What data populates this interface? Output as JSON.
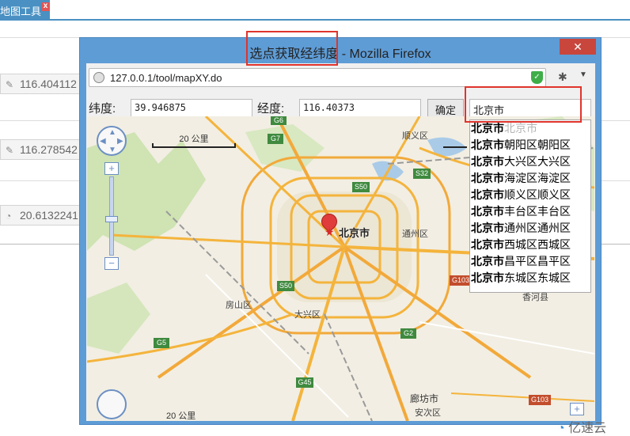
{
  "background": {
    "tab_label": "地图工具",
    "tab_close": "x",
    "fields": [
      "116.404112",
      "116.278542",
      "20.6132241"
    ]
  },
  "window": {
    "title_highlight": "选点获取经纬度",
    "title_rest": " - Mozilla Firefox",
    "close_symbol": "✕",
    "url": "127.0.0.1/tool/mapXY.do"
  },
  "form": {
    "lat_label": "纬度:",
    "lat_value": "39.946875",
    "lng_label": "经度:",
    "lng_value": "116.40373",
    "confirm_label": "确定",
    "search_value": "北京市"
  },
  "suggestions": [
    {
      "bold": "北京市",
      "rest": "北京市",
      "ghost": true
    },
    {
      "bold": "北京市",
      "rest": "朝阳区朝阳区"
    },
    {
      "bold": "北京市",
      "rest": "大兴区大兴区"
    },
    {
      "bold": "北京市",
      "rest": "海淀区海淀区"
    },
    {
      "bold": "北京市",
      "rest": "顺义区顺义区"
    },
    {
      "bold": "北京市",
      "rest": "丰台区丰台区"
    },
    {
      "bold": "北京市",
      "rest": "通州区通州区"
    },
    {
      "bold": "北京市",
      "rest": "西城区西城区"
    },
    {
      "bold": "北京市",
      "rest": "昌平区昌平区"
    },
    {
      "bold": "北京市",
      "rest": "东城区东城区"
    }
  ],
  "map": {
    "scale_top": "20 公里",
    "scale_bottom": "20 公里",
    "marker_label": "北京市",
    "places": {
      "shunyi": "顺义区",
      "tongzhou": "通州区",
      "fangshan": "房山区",
      "daxing": "大兴区",
      "xianghe": "香河县",
      "langfang": "廊坊市",
      "anci": "安次区"
    },
    "shields": {
      "g6": "G6",
      "g7": "G7",
      "s32": "S32",
      "s50": "S50",
      "s50b": "S50",
      "g103": "G103",
      "g2": "G2",
      "g5": "G5",
      "g45": "G45",
      "g103b": "G103"
    },
    "zoom_plus": "+",
    "zoom_minus": "−"
  },
  "watermark": "亿速云"
}
